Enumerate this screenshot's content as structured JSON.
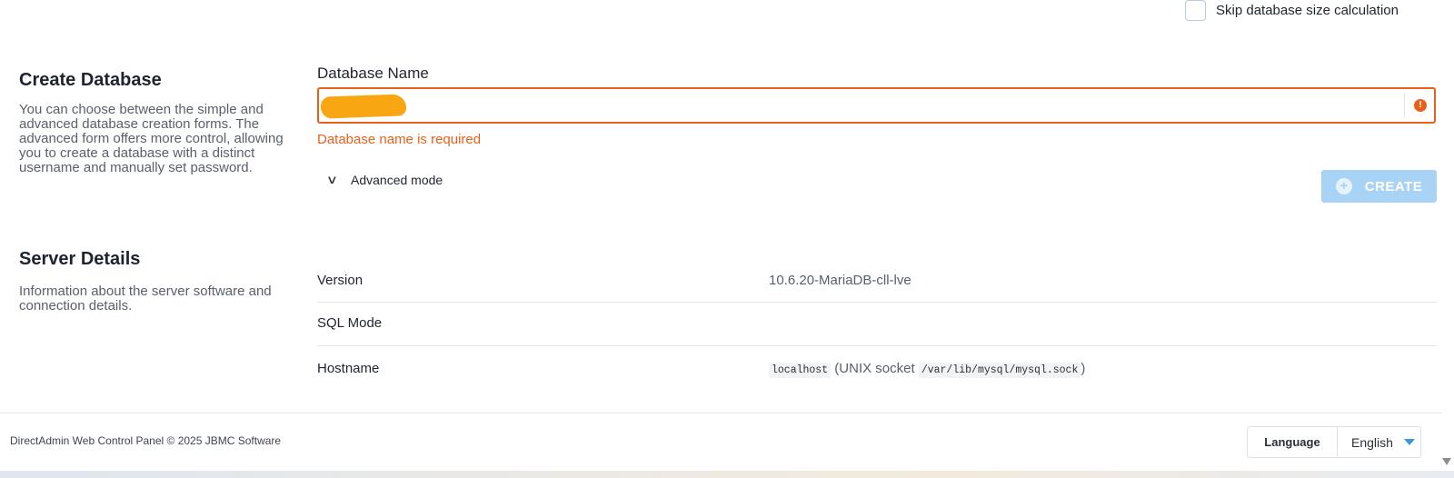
{
  "skip_option": {
    "label": "Skip database size calculation",
    "checked": false
  },
  "create_section": {
    "title": "Create Database",
    "description": "You can choose between the simple and advanced database creation forms. The advanced form offers more control, allowing you to create a database with a distinct username and manually set password.",
    "field_label": "Database Name",
    "input_value": "",
    "error": "Database name is required",
    "error_icon": "!",
    "advanced_label": "Advanced mode",
    "create_button": "CREATE",
    "create_icon": "+"
  },
  "server_section": {
    "title": "Server Details",
    "description": "Information about the server software and connection details.",
    "rows": [
      {
        "label": "Version",
        "value": "10.6.20-MariaDB-cll-lve"
      },
      {
        "label": "SQL Mode",
        "value": ""
      },
      {
        "label": "Hostname",
        "host": "localhost",
        "socket_prefix": "(UNIX socket",
        "socket_path": "/var/lib/mysql/mysql.sock",
        "socket_suffix": ")"
      }
    ]
  },
  "footer": {
    "copyright": "DirectAdmin Web Control Panel © 2025 JBMC Software",
    "language_label": "Language",
    "language_value": "English"
  },
  "colors": {
    "error": "#e8611b",
    "accent": "#3a96dd",
    "create_disabled": "#a8d3f4",
    "redaction": "#f8a712"
  },
  "icons": {
    "checkbox": "checkbox-icon",
    "error": "alert-circle-icon",
    "chevron": "chevron-down-icon",
    "plus": "plus-circle-icon",
    "caret": "caret-down-icon"
  }
}
